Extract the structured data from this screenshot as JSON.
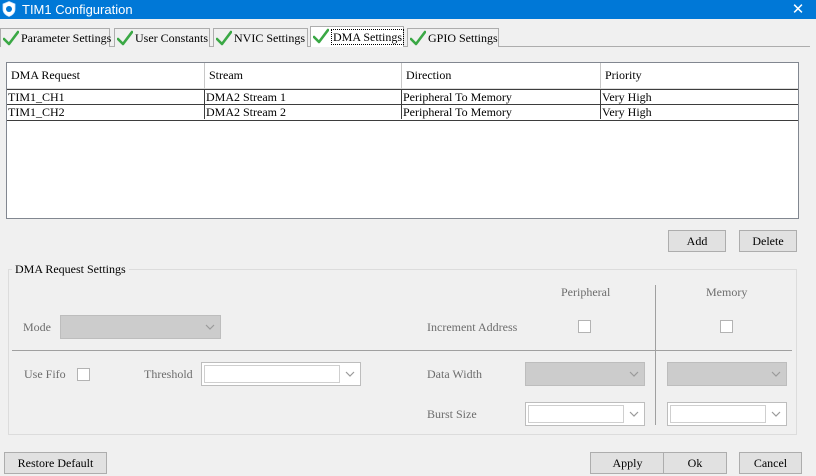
{
  "window": {
    "title": "TIM1 Configuration",
    "close_glyph": "✕"
  },
  "tabs": [
    {
      "label": "Parameter Settings",
      "icon": "check-icon"
    },
    {
      "label": "User Constants",
      "icon": "check-icon"
    },
    {
      "label": "NVIC Settings",
      "icon": "check-icon"
    },
    {
      "label": "DMA Settings",
      "icon": "check-icon",
      "active": true
    },
    {
      "label": "GPIO Settings",
      "icon": "check-icon"
    }
  ],
  "dma_table": {
    "headers": [
      "DMA Request",
      "Stream",
      "Direction",
      "Priority"
    ],
    "rows": [
      [
        "TIM1_CH1",
        "DMA2 Stream 1",
        "Peripheral To Memory",
        "Very High"
      ],
      [
        "TIM1_CH2",
        "DMA2 Stream 2",
        "Peripheral To Memory",
        "Very High"
      ]
    ]
  },
  "table_actions": {
    "add": "Add",
    "delete": "Delete"
  },
  "settings": {
    "group_title": "DMA Request Settings",
    "col_peripheral": "Peripheral",
    "col_memory": "Memory",
    "mode_label": "Mode",
    "increment_label": "Increment Address",
    "use_fifo_label": "Use Fifo",
    "threshold_label": "Threshold",
    "data_width_label": "Data Width",
    "burst_size_label": "Burst Size"
  },
  "footer": {
    "restore_default": "Restore Default",
    "apply": "Apply",
    "ok": "Ok",
    "cancel": "Cancel"
  },
  "colors": {
    "titlebar": "#0078d7",
    "check": "#3aa845",
    "disabled_combo": "#cccccc"
  }
}
